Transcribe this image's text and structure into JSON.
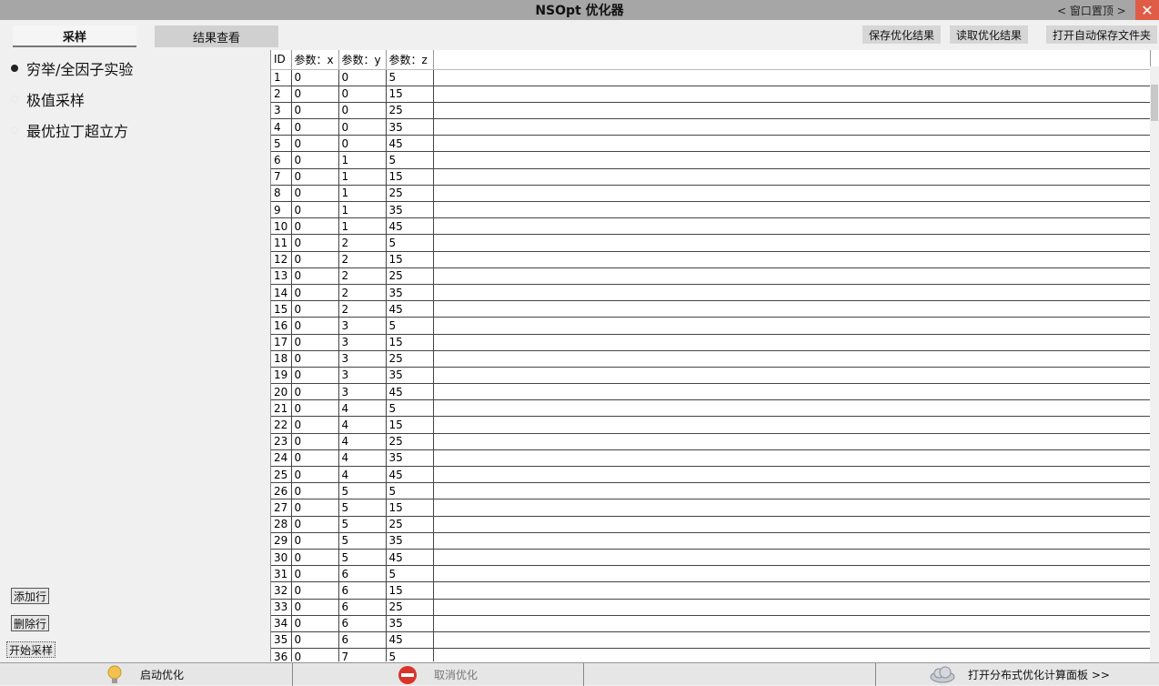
{
  "window": {
    "title": "NSOpt 优化器",
    "pin_label": "< 窗口置顶 >",
    "close_label": "✕"
  },
  "tabs": [
    {
      "label": "采样"
    },
    {
      "label": "结果查看"
    }
  ],
  "toolbar": {
    "save_label": "保存优化结果",
    "load_label": "读取优化结果",
    "open_folder_label": "打开自动保存文件夹"
  },
  "sampling_methods": [
    {
      "label": "穷举/全因子实验",
      "selected": true
    },
    {
      "label": "极值采样",
      "selected": false
    },
    {
      "label": "最优拉丁超立方",
      "selected": false
    }
  ],
  "left_buttons": {
    "add_row": "添加行",
    "delete_row": "删除行",
    "start_sampling": "开始采样"
  },
  "table": {
    "headers": [
      "ID",
      "参数：x",
      "参数：y",
      "参数：z"
    ],
    "rows": [
      [
        "1",
        "0",
        "0",
        "5"
      ],
      [
        "2",
        "0",
        "0",
        "15"
      ],
      [
        "3",
        "0",
        "0",
        "25"
      ],
      [
        "4",
        "0",
        "0",
        "35"
      ],
      [
        "5",
        "0",
        "0",
        "45"
      ],
      [
        "6",
        "0",
        "1",
        "5"
      ],
      [
        "7",
        "0",
        "1",
        "15"
      ],
      [
        "8",
        "0",
        "1",
        "25"
      ],
      [
        "9",
        "0",
        "1",
        "35"
      ],
      [
        "10",
        "0",
        "1",
        "45"
      ],
      [
        "11",
        "0",
        "2",
        "5"
      ],
      [
        "12",
        "0",
        "2",
        "15"
      ],
      [
        "13",
        "0",
        "2",
        "25"
      ],
      [
        "14",
        "0",
        "2",
        "35"
      ],
      [
        "15",
        "0",
        "2",
        "45"
      ],
      [
        "16",
        "0",
        "3",
        "5"
      ],
      [
        "17",
        "0",
        "3",
        "15"
      ],
      [
        "18",
        "0",
        "3",
        "25"
      ],
      [
        "19",
        "0",
        "3",
        "35"
      ],
      [
        "20",
        "0",
        "3",
        "45"
      ],
      [
        "21",
        "0",
        "4",
        "5"
      ],
      [
        "22",
        "0",
        "4",
        "15"
      ],
      [
        "23",
        "0",
        "4",
        "25"
      ],
      [
        "24",
        "0",
        "4",
        "35"
      ],
      [
        "25",
        "0",
        "4",
        "45"
      ],
      [
        "26",
        "0",
        "5",
        "5"
      ],
      [
        "27",
        "0",
        "5",
        "15"
      ],
      [
        "28",
        "0",
        "5",
        "25"
      ],
      [
        "29",
        "0",
        "5",
        "35"
      ],
      [
        "30",
        "0",
        "5",
        "45"
      ],
      [
        "31",
        "0",
        "6",
        "5"
      ],
      [
        "32",
        "0",
        "6",
        "15"
      ],
      [
        "33",
        "0",
        "6",
        "25"
      ],
      [
        "34",
        "0",
        "6",
        "35"
      ],
      [
        "35",
        "0",
        "6",
        "45"
      ],
      [
        "36",
        "0",
        "7",
        "5"
      ]
    ]
  },
  "bottom": {
    "start_label": "启动优化",
    "start_icon": "lightbulb-icon",
    "cancel_label": "取消优化",
    "cancel_icon": "stop-icon",
    "distributed_label": "打开分布式优化计算面板 >>",
    "distributed_icon": "cloud-icon"
  },
  "colors": {
    "close": "#e05c46",
    "stop": "#d9342b",
    "bulb": "#f2c14e"
  }
}
